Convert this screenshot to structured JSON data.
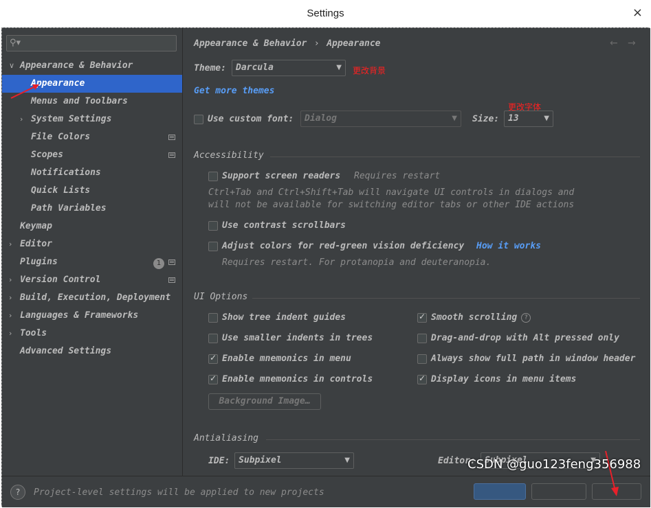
{
  "window": {
    "title": "Settings",
    "close": "×"
  },
  "search": {
    "icon": "search-icon",
    "placeholder": ""
  },
  "sidebar": {
    "items": [
      {
        "label": "Appearance & Behavior",
        "chevron": "∨"
      },
      {
        "label": "Appearance"
      },
      {
        "label": "Menus and Toolbars"
      },
      {
        "label": "System Settings",
        "chevron": "›"
      },
      {
        "label": "File Colors"
      },
      {
        "label": "Scopes"
      },
      {
        "label": "Notifications"
      },
      {
        "label": "Quick Lists"
      },
      {
        "label": "Path Variables"
      },
      {
        "label": "Keymap"
      },
      {
        "label": "Editor",
        "chevron": "›"
      },
      {
        "label": "Plugins",
        "badge": "1"
      },
      {
        "label": "Version Control",
        "chevron": "›"
      },
      {
        "label": "Build, Execution, Deployment",
        "chevron": "›"
      },
      {
        "label": "Languages & Frameworks",
        "chevron": "›"
      },
      {
        "label": "Tools",
        "chevron": "›"
      },
      {
        "label": "Advanced Settings"
      }
    ]
  },
  "breadcrumb": {
    "parent": "Appearance & Behavior",
    "sep": "›",
    "current": "Appearance",
    "back": "←",
    "forward": "→"
  },
  "theme": {
    "label": "Theme:",
    "value": "Darcula",
    "annotation": "更改背景"
  },
  "get_more_themes": "Get more themes",
  "font": {
    "label": "Use custom font:",
    "value": "Dialog",
    "size_label": "Size:",
    "size_value": "13",
    "annotation": "更改字体"
  },
  "accessibility": {
    "header": "Accessibility",
    "screen_readers": "Support screen readers",
    "requires_restart": "Requires restart",
    "note_line1": "Ctrl+Tab and Ctrl+Shift+Tab will navigate UI controls in dialogs and",
    "note_line2": "will not be available for switching editor tabs or other IDE actions",
    "contrast": "Use contrast scrollbars",
    "adjust": "Adjust colors for red-green vision deficiency",
    "how_it_works": "How it works",
    "adjust_note": "Requires restart. For protanopia and deuteranopia."
  },
  "ui_options": {
    "header": "UI Options",
    "tree_indent": "Show tree indent guides",
    "smaller_indents": "Use smaller indents in trees",
    "mnemonics_menu": "Enable mnemonics in menu",
    "mnemonics_controls": "Enable mnemonics in controls",
    "smooth_scrolling": "Smooth scrolling",
    "drag_drop": "Drag-and-drop with Alt pressed only",
    "full_path": "Always show full path in window header",
    "display_icons": "Display icons in menu items",
    "background_image": "Background Image…",
    "help": "?"
  },
  "antialiasing": {
    "header": "Antialiasing",
    "ide_label": "IDE:",
    "ide_value": "Subpixel",
    "editor_label": "Editor:",
    "editor_value": "Subpixel"
  },
  "footer": {
    "help": "?",
    "note": "Project-level settings will be applied to new projects"
  },
  "watermark": "CSDN @guo123feng356988"
}
